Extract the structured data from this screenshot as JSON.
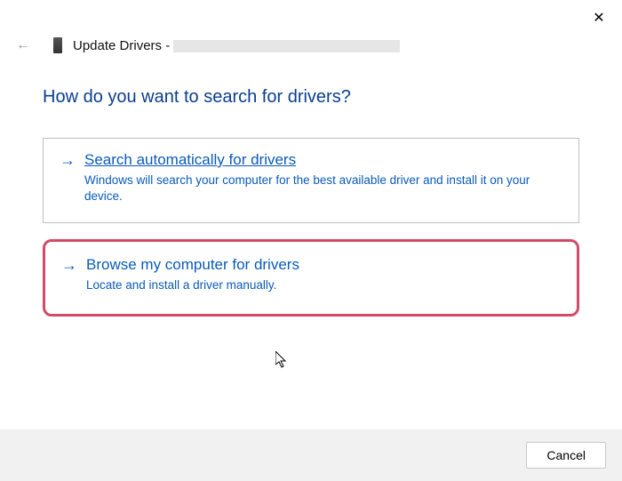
{
  "window": {
    "title_prefix": "Update Drivers - "
  },
  "heading": "How do you want to search for drivers?",
  "options": [
    {
      "title": "Search automatically for drivers",
      "desc": "Windows will search your computer for the best available driver and install it on your device."
    },
    {
      "title": "Browse my computer for drivers",
      "desc": "Locate and install a driver manually."
    }
  ],
  "footer": {
    "cancel": "Cancel"
  }
}
